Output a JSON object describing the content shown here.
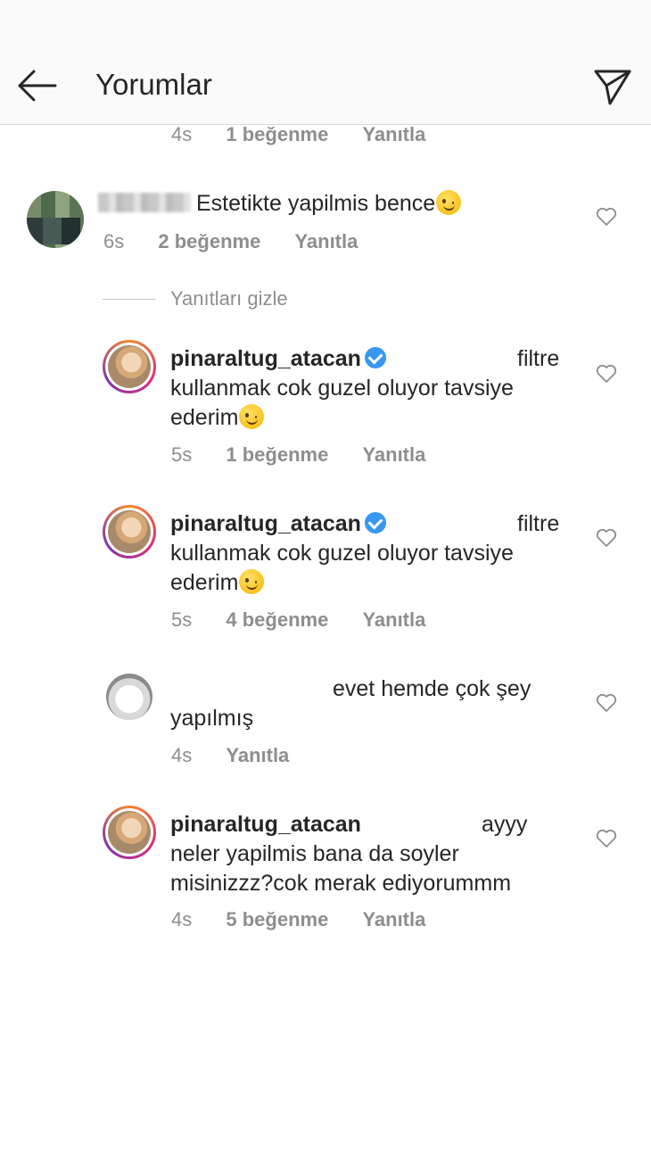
{
  "header": {
    "title": "Yorumlar"
  },
  "top_meta": {
    "time": "4s",
    "likes": "1 beğenme",
    "reply": "Yanıtla"
  },
  "comments": [
    {
      "text": "Estetikte yapilmis bence",
      "time": "6s",
      "likes": "2 beğenme",
      "reply": "Yanıtla"
    }
  ],
  "hide_replies": {
    "label": "Yanıtları gizle"
  },
  "replies": [
    {
      "username": "pinaraltug_atacan",
      "line1_tail": "filtre",
      "line2": "kullanmak cok guzel oluyor tavsiye",
      "line3": "ederim",
      "time": "5s",
      "likes": "1 beğenme",
      "reply": "Yanıtla"
    },
    {
      "username": "pinaraltug_atacan",
      "line1_tail": "filtre",
      "line2": "kullanmak cok guzel oluyor tavsiye",
      "line3": "ederim",
      "time": "5s",
      "likes": "4 beğenme",
      "reply": "Yanıtla"
    },
    {
      "line1_tail": "evet hemde çok şey",
      "line2": "yapılmış",
      "time": "4s",
      "reply": "Yanıtla"
    },
    {
      "username": "pinaraltug_atacan",
      "line1_tail": "ayyy",
      "line2": "neler yapilmis bana da soyler",
      "line3": "misinizzz?cok merak ediyorummm",
      "time": "4s",
      "likes": "5 beğenme",
      "reply": "Yanıtla"
    }
  ],
  "icons": {
    "back": "arrow-left-icon",
    "send": "paper-plane-icon",
    "like": "heart-outline-icon",
    "verified": "verified-badge-icon",
    "emoji": "winking-face-emoji"
  }
}
